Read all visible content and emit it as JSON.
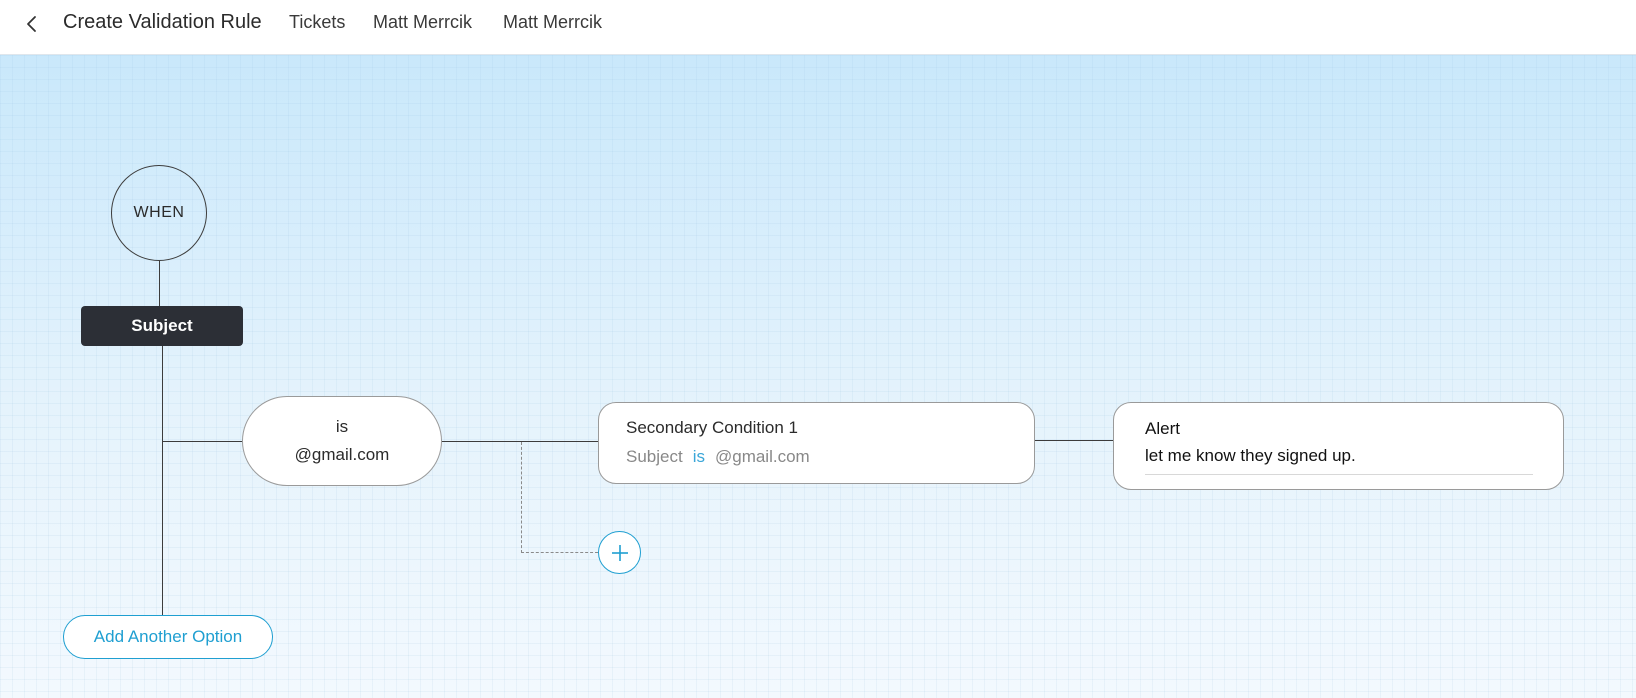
{
  "header": {
    "back_icon": "chevron-left-icon",
    "title": "Create Validation Rule",
    "breadcrumbs": [
      "Tickets",
      "Matt Merrcik",
      "Matt Merrcik"
    ]
  },
  "flow": {
    "when_label": "WHEN",
    "field_label": "Subject",
    "condition": {
      "operator": "is",
      "value": "@gmail.com"
    },
    "secondary": {
      "title": "Secondary Condition 1",
      "field": "Subject",
      "operator": "is",
      "value": "@gmail.com"
    },
    "action": {
      "title": "Alert",
      "message": "let me know they signed up."
    },
    "add_condition_symbol": "+",
    "add_option_label": "Add Another Option"
  },
  "colors": {
    "accent": "#1f9fd1",
    "node_dark": "#2c2f36",
    "canvas_top": "#c9e8fb",
    "canvas_bottom": "#f3f9fe"
  }
}
